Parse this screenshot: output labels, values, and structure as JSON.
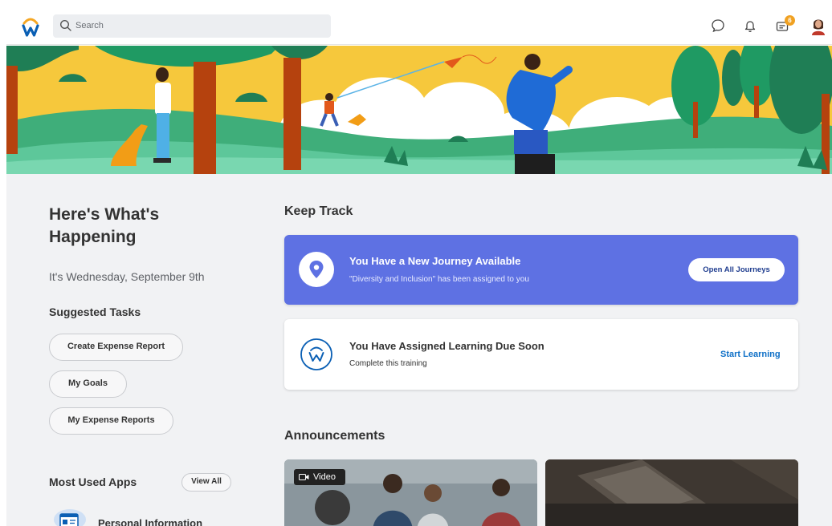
{
  "search": {
    "placeholder": "Search"
  },
  "header": {
    "notification_count": "6"
  },
  "left": {
    "headline": "Here's What's Happening",
    "date": "It's Wednesday, September 9th",
    "suggested_tasks_title": "Suggested Tasks",
    "tasks": [
      "Create Expense Report",
      "My Goals",
      "My Expense Reports"
    ],
    "most_used_apps_title": "Most Used Apps",
    "view_all": "View All",
    "apps": [
      "Personal Information"
    ]
  },
  "keep_track": {
    "title": "Keep Track",
    "journey": {
      "title": "You Have a New Journey Available",
      "subtitle": "\"Diversity and Inclusion\" has been assigned to you",
      "button": "Open All Journeys"
    },
    "learning": {
      "title": "You Have Assigned Learning Due Soon",
      "subtitle": "Complete this training",
      "link": "Start Learning"
    }
  },
  "announcements": {
    "title": "Announcements",
    "video_tag": "Video"
  },
  "colors": {
    "journey_card": "#5e71e3",
    "link_blue": "#0d6fc7",
    "badge": "#f0a122",
    "logo_orange": "#f5a623",
    "logo_blue": "#0a5fb4"
  }
}
